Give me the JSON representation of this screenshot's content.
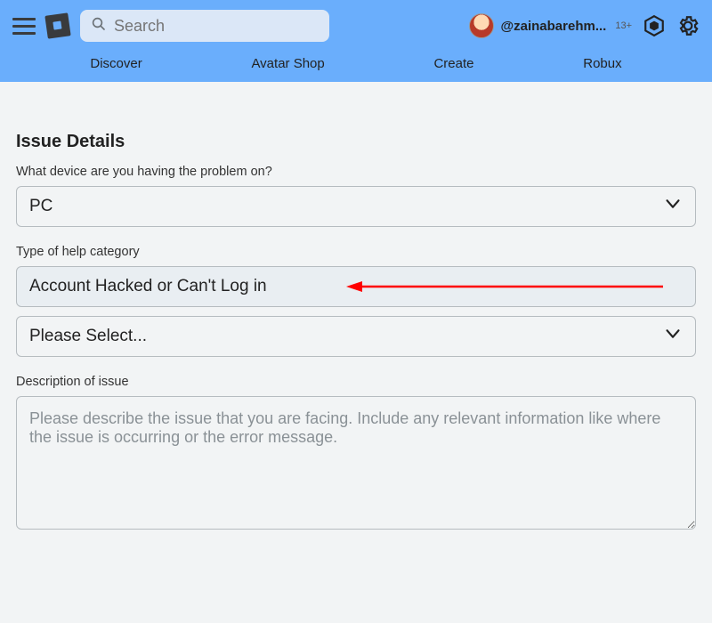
{
  "header": {
    "search_placeholder": "Search",
    "username": "@zainabarehm...",
    "age_badge": "13+"
  },
  "nav": {
    "tabs": [
      "Discover",
      "Avatar Shop",
      "Create",
      "Robux"
    ]
  },
  "form": {
    "section_title": "Issue Details",
    "device_label": "What device are you having the problem on?",
    "device_value": "PC",
    "category_label": "Type of help category",
    "category_value": "Account Hacked or Can't Log in",
    "subcategory_value": "Please Select...",
    "description_label": "Description of issue",
    "description_placeholder": "Please describe the issue that you are facing. Include any relevant information like where the issue is occurring or the error message."
  },
  "colors": {
    "header_bg": "#6aaefc",
    "annotation": "#ff0000"
  }
}
